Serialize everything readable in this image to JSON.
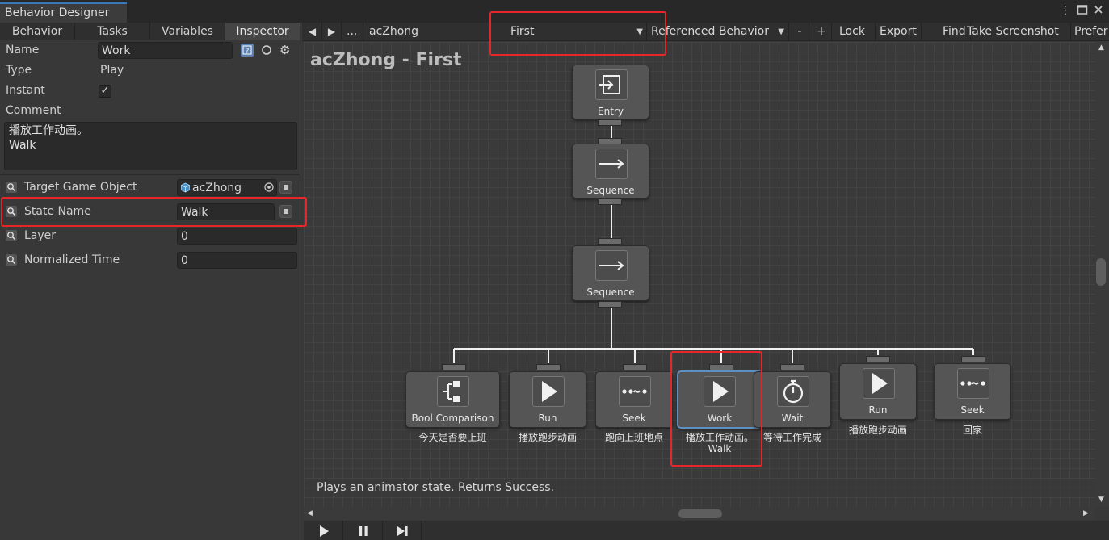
{
  "window": {
    "title": "Behavior Designer",
    "menu_icon": "kebab-icon",
    "maximize_icon": "maximize-icon",
    "close_icon": "close-icon"
  },
  "left_tabs": [
    {
      "label": "Behavior",
      "active": false
    },
    {
      "label": "Tasks",
      "active": false
    },
    {
      "label": "Variables",
      "active": false
    },
    {
      "label": "Inspector",
      "active": true
    }
  ],
  "inspector": {
    "name_label": "Name",
    "name_value": "Work",
    "type_label": "Type",
    "type_value": "Play",
    "instant_label": "Instant",
    "instant_checked": true,
    "check_glyph": "✓",
    "comment_label": "Comment",
    "comment_value": "播放工作动画。\nWalk",
    "fields": [
      {
        "label": "Target Game Object",
        "value": "acZhong"
      },
      {
        "label": "State Name",
        "value": "Walk"
      },
      {
        "label": "Layer",
        "value": "0"
      },
      {
        "label": "Normalized Time",
        "value": "0"
      }
    ]
  },
  "toolbar": {
    "prev_icon": "◀",
    "next_icon": "▶",
    "ellipsis": "...",
    "behavior_name": "acZhong",
    "selected_behavior": "First",
    "referenced_behavior": "Referenced Behavior",
    "minus": "-",
    "plus": "+",
    "lock": "Lock",
    "export": "Export",
    "find": "Find",
    "screenshot": "Take Screenshot",
    "preferences": "Prefer"
  },
  "graph": {
    "title": "acZhong - First",
    "description": "Plays an animator state. Returns Success.",
    "nodes": [
      {
        "id": "entry",
        "label": "Entry",
        "icon": "entry-icon"
      },
      {
        "id": "sequence-1",
        "label": "Sequence",
        "icon": "sequence-icon"
      },
      {
        "id": "sequence-2",
        "label": "Sequence",
        "icon": "sequence-icon"
      },
      {
        "id": "bool-comparison",
        "label": "Bool Comparison",
        "comment": "今天是否要上班",
        "icon": "bool-comparison-icon"
      },
      {
        "id": "run-1",
        "label": "Run",
        "comment": "播放跑步动画",
        "icon": "play-icon"
      },
      {
        "id": "seek-1",
        "label": "Seek",
        "comment": "跑向上班地点",
        "icon": "seek-icon"
      },
      {
        "id": "work",
        "label": "Work",
        "comment": "播放工作动画。",
        "comment2": "Walk",
        "icon": "play-icon",
        "selected": true
      },
      {
        "id": "wait",
        "label": "Wait",
        "comment": "等待工作完成",
        "icon": "stopwatch-icon"
      },
      {
        "id": "run-2",
        "label": "Run",
        "comment": "播放跑步动画",
        "icon": "play-icon"
      },
      {
        "id": "seek-2",
        "label": "Seek",
        "comment": "回家",
        "icon": "seek-icon"
      }
    ]
  },
  "playback": {
    "play": "play-icon",
    "pause": "pause-icon",
    "step": "step-icon"
  },
  "colors": {
    "highlight": "#e8262a",
    "selection": "#5d8fc2"
  }
}
